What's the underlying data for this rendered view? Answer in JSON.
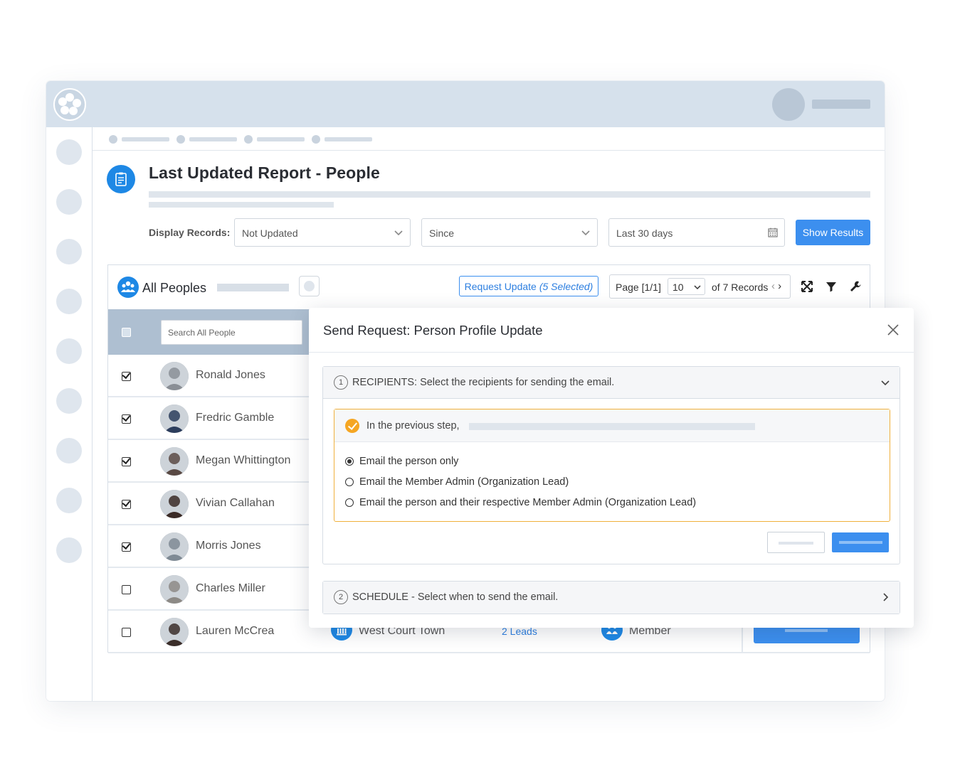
{
  "header": {
    "title": "Last Updated Report - People"
  },
  "filters": {
    "label": "Display Records:",
    "status": "Not Updated",
    "since": "Since",
    "range": "Last 30 days",
    "show_results": "Show Results"
  },
  "panel": {
    "title": "All Peoples",
    "request_update": "Request Update",
    "request_selected": "(5 Selected)",
    "page": "Page [1/1]",
    "page_size": "10",
    "records": "of 7 Records",
    "search_placeholder": "Search All People"
  },
  "rows": [
    {
      "name": "Ronald Jones",
      "checked": true,
      "photo_color": "#8a8f96"
    },
    {
      "name": "Fredric Gamble",
      "checked": true,
      "photo_color": "#2c3d5c"
    },
    {
      "name": "Megan Whittington",
      "checked": true,
      "photo_color": "#5a4a44"
    },
    {
      "name": "Vivian Callahan",
      "checked": true,
      "photo_color": "#3a2a26"
    },
    {
      "name": "Morris Jones",
      "checked": true,
      "photo_color": "#7f8a94"
    },
    {
      "name": "Charles Miller",
      "checked": false,
      "photo_color": "#8d8a86"
    },
    {
      "name": "Lauren McCrea",
      "checked": false,
      "photo_color": "#3b2e2a",
      "org": "West Court Town",
      "leads": "2 Leads",
      "role": "Member"
    }
  ],
  "modal": {
    "title": "Send Request: Person Profile Update",
    "step1_num": "1",
    "step1_title": "RECIPIENTS: Select the recipients for sending the email.",
    "notice": "In the previous step,",
    "options": [
      {
        "label": "Email the person only",
        "selected": true
      },
      {
        "label": "Email the Member Admin (Organization Lead)",
        "selected": false
      },
      {
        "label": "Email the person and their respective Member Admin (Organization Lead)",
        "selected": false
      }
    ],
    "step2_num": "2",
    "step2_title": "SCHEDULE - Select when to send the email."
  },
  "colors": {
    "accent": "#3c8fef",
    "brand": "#1e88e5",
    "warning": "#f5a623",
    "topbar": "#d6e1ec"
  }
}
